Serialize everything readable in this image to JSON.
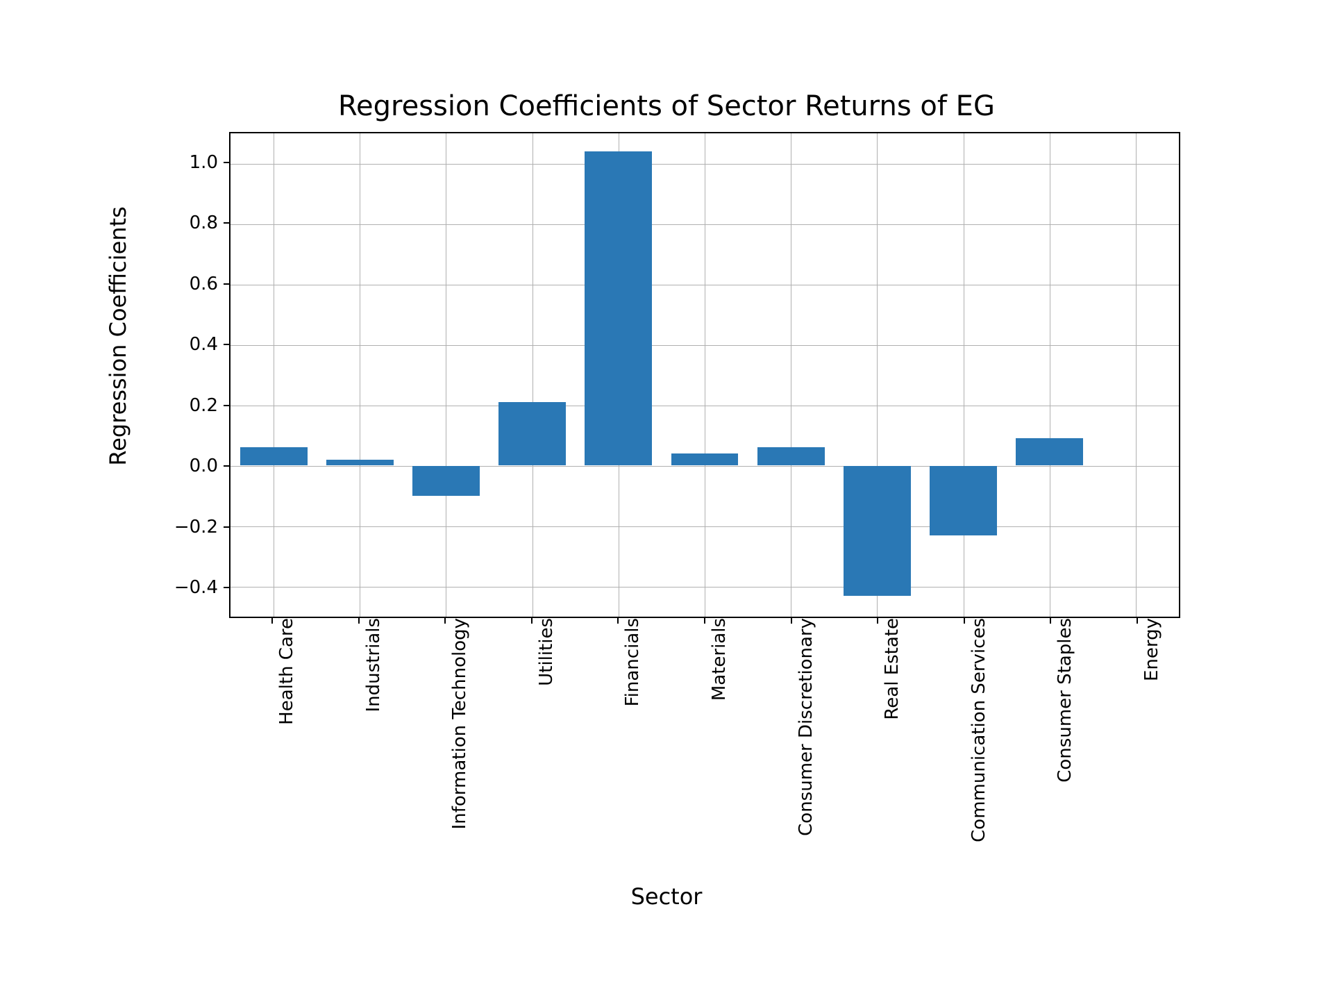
{
  "chart_data": {
    "type": "bar",
    "title": "Regression Coefficients of Sector Returns of EG",
    "xlabel": "Sector",
    "ylabel": "Regression Coefficients",
    "categories": [
      "Health Care",
      "Industrials",
      "Information Technology",
      "Utilities",
      "Financials",
      "Materials",
      "Consumer Discretionary",
      "Real Estate",
      "Communication Services",
      "Consumer Staples",
      "Energy"
    ],
    "values": [
      0.06,
      0.02,
      -0.1,
      0.21,
      1.04,
      0.04,
      0.06,
      -0.43,
      -0.23,
      0.09,
      0.0
    ],
    "ylim": [
      -0.5,
      1.1
    ],
    "yticks": [
      -0.4,
      -0.2,
      0.0,
      0.2,
      0.4,
      0.6,
      0.8,
      1.0
    ],
    "ytick_labels": [
      "−0.4",
      "−0.2",
      "0.0",
      "0.2",
      "0.4",
      "0.6",
      "0.8",
      "1.0"
    ],
    "bar_color": "#2a78b5",
    "bar_width_frac": 0.78
  }
}
